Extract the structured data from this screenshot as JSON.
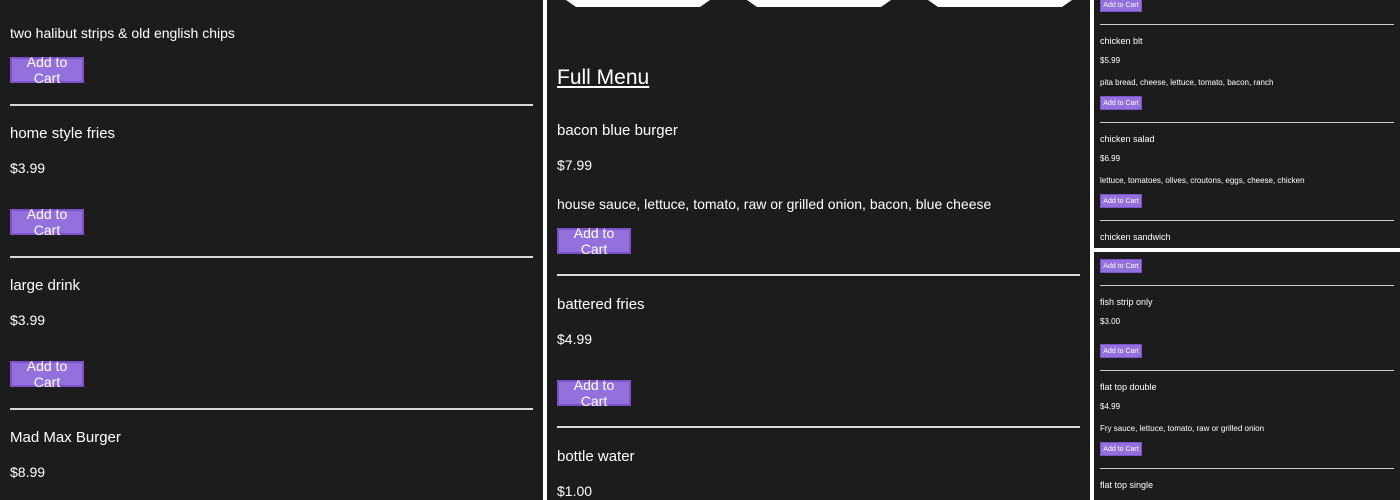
{
  "add_label": "Add to Cart",
  "left": {
    "top_desc": "two halibut strips & old english chips",
    "items": [
      {
        "name": "home style fries",
        "price": "$3.99"
      },
      {
        "name": "large drink",
        "price": "$3.99"
      },
      {
        "name": "Mad Max Burger",
        "price": "$8.99"
      }
    ]
  },
  "mid": {
    "heading": "Full Menu",
    "items": [
      {
        "name": "bacon blue burger",
        "price": "$7.99",
        "desc": "house sauce, lettuce, tomato, raw or grilled onion, bacon, blue cheese"
      },
      {
        "name": "battered fries",
        "price": "$4.99"
      },
      {
        "name": "bottle water",
        "price": "$1.00"
      }
    ]
  },
  "right_top": {
    "items": [
      {
        "name": "chicken blt",
        "price": "$5.99",
        "desc": "pita bread, cheese, lettuce, tomato, bacon, ranch"
      },
      {
        "name": "chicken salad",
        "price": "$6.99",
        "desc": "lettuce, tomatoes, olives, croutons, eggs, cheese, chicken"
      },
      {
        "name": "chicken sandwich"
      }
    ]
  },
  "right_bottom": {
    "items": [
      {
        "name": "fish strip only",
        "price": "$3.00"
      },
      {
        "name": "flat top double",
        "price": "$4.99",
        "desc": "Fry sauce, lettuce, tomato, raw or grilled onion"
      },
      {
        "name": "flat top single"
      }
    ]
  },
  "colors": {
    "background": "#1c1c1c",
    "button": "#9370db",
    "divider": "#d9d9d9"
  }
}
